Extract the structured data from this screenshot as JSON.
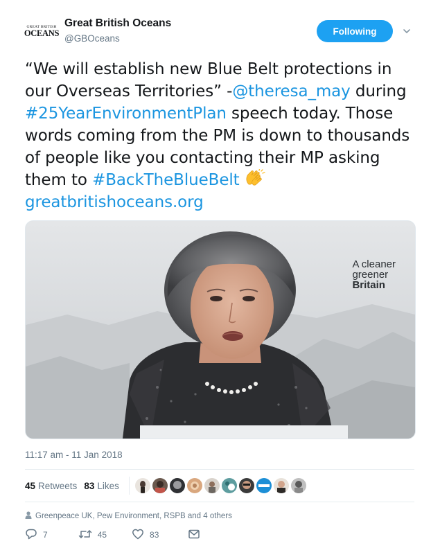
{
  "account": {
    "logo_top": "GREAT BRITISH",
    "logo_bottom": "OCEANS",
    "display_name": "Great British Oceans",
    "handle": "@GBOceans",
    "follow_label": "Following"
  },
  "tweet": {
    "text_part1": "“We will establish new Blue Belt protections in our Overseas Territories” -",
    "mention": "@theresa_may",
    "text_part2": " during ",
    "hashtag1": "#25YearEnvironmentPlan",
    "text_part3": " speech today. Those words coming from the PM is down to thousands of people like you contacting their MP asking them to ",
    "hashtag2": "#BackTheBlueBelt",
    "link": "greatbritishoceans.org"
  },
  "media": {
    "caption_line1": "A cleaner",
    "caption_line2": "greener",
    "caption_line3": "Britain"
  },
  "timestamp": "11:17 am - 11 Jan 2018",
  "stats": {
    "retweets_count": "45",
    "retweets_label": "Retweets",
    "likes_count": "83",
    "likes_label": "Likes"
  },
  "liked_by": "Greenpeace UK, Pew Environment, RSPB and 4 others",
  "actions": {
    "reply_count": "7",
    "retweet_count": "45",
    "like_count": "83"
  },
  "colors": {
    "accent": "#1da1f2",
    "link": "#1b95e0",
    "muted": "#657786"
  },
  "icons": [
    "chevron-down-icon",
    "clap-emoji-icon",
    "user-icon",
    "reply-icon",
    "retweet-icon",
    "heart-icon",
    "envelope-icon"
  ]
}
